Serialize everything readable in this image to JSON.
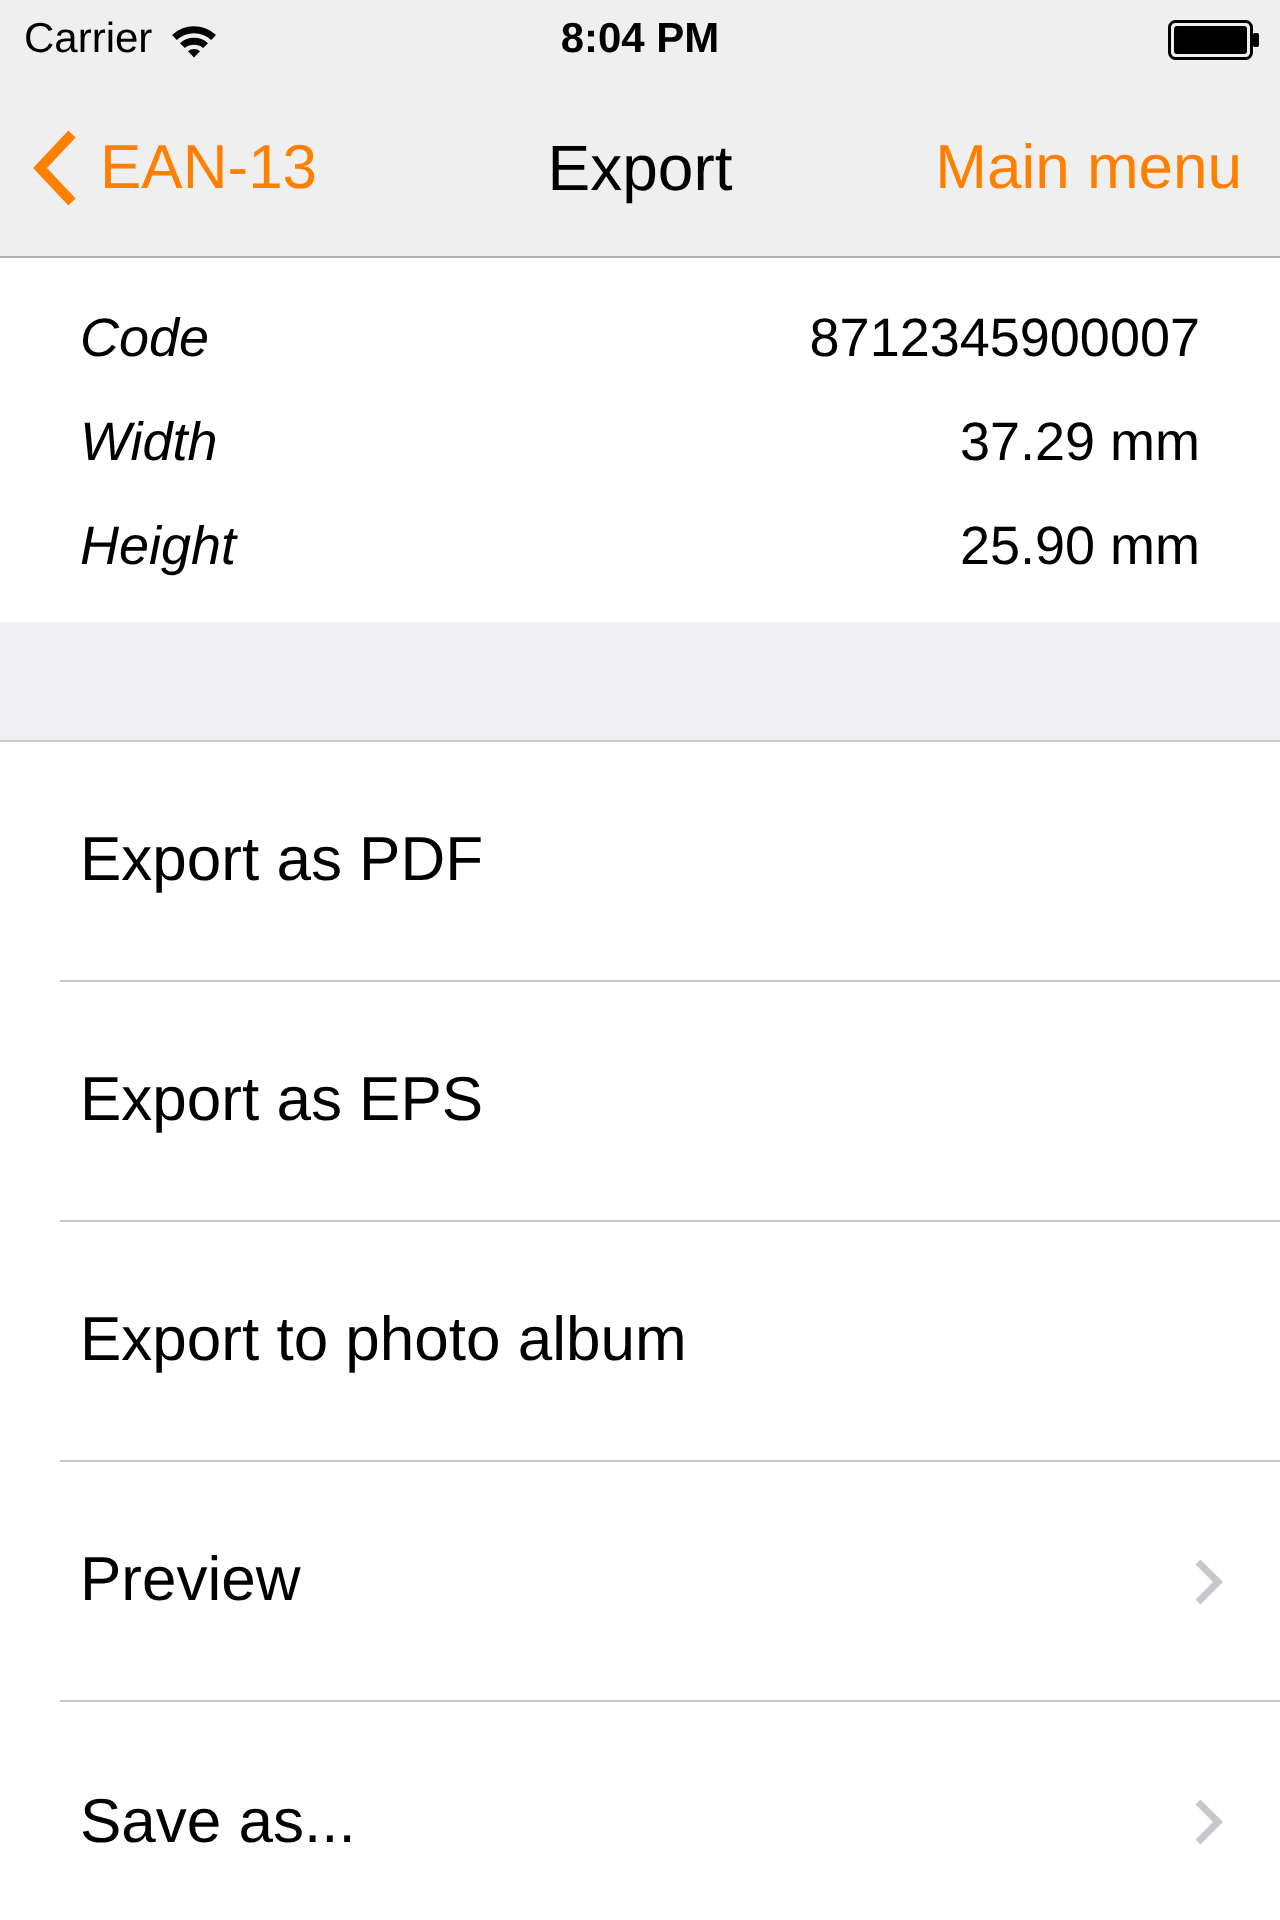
{
  "status_bar": {
    "carrier": "Carrier",
    "time": "8:04 PM"
  },
  "nav_bar": {
    "back_label": "EAN-13",
    "title": "Export",
    "right_button": "Main menu"
  },
  "info": [
    {
      "label": "Code",
      "value": "8712345900007"
    },
    {
      "label": "Width",
      "value": "37.29 mm"
    },
    {
      "label": "Height",
      "value": "25.90 mm"
    }
  ],
  "actions": [
    {
      "label": "Export as PDF",
      "disclosure": false
    },
    {
      "label": "Export as EPS",
      "disclosure": false
    },
    {
      "label": "Export to photo album",
      "disclosure": false
    },
    {
      "label": "Preview",
      "disclosure": true
    },
    {
      "label": "Save as...",
      "disclosure": true
    }
  ]
}
